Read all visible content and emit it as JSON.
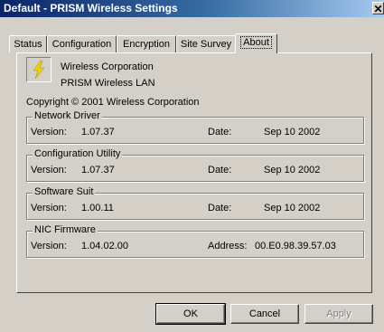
{
  "window": {
    "title": "Default - PRISM Wireless Settings",
    "close_label": "✕"
  },
  "tabs": [
    {
      "label": "Status"
    },
    {
      "label": "Configuration"
    },
    {
      "label": "Encryption"
    },
    {
      "label": "Site Survey"
    },
    {
      "label": "About"
    }
  ],
  "about": {
    "company": "Wireless Corporation",
    "product": "PRISM Wireless LAN",
    "copyright": "Copyright © 2001  Wireless Corporation",
    "groups": [
      {
        "title": "Network Driver",
        "left_label": "Version:",
        "left_value": "1.07.37",
        "right_label": "Date:",
        "right_value": "Sep 10 2002"
      },
      {
        "title": "Configuration Utility",
        "left_label": "Version:",
        "left_value": "1.07.37",
        "right_label": "Date:",
        "right_value": "Sep 10 2002"
      },
      {
        "title": "Software Suit",
        "left_label": "Version:",
        "left_value": "1.00.11",
        "right_label": "Date:",
        "right_value": "Sep 10 2002"
      },
      {
        "title": "NIC Firmware",
        "left_label": "Version:",
        "left_value": "1.04.02.00",
        "right_label": "Address:",
        "right_value": "00.E0.98.39.57.03"
      }
    ]
  },
  "buttons": {
    "ok": "OK",
    "cancel": "Cancel",
    "apply": "Apply"
  },
  "colors": {
    "titlebar": "#0a246a",
    "face": "#d4d0c8",
    "logo_bolt": "#f0d000"
  }
}
